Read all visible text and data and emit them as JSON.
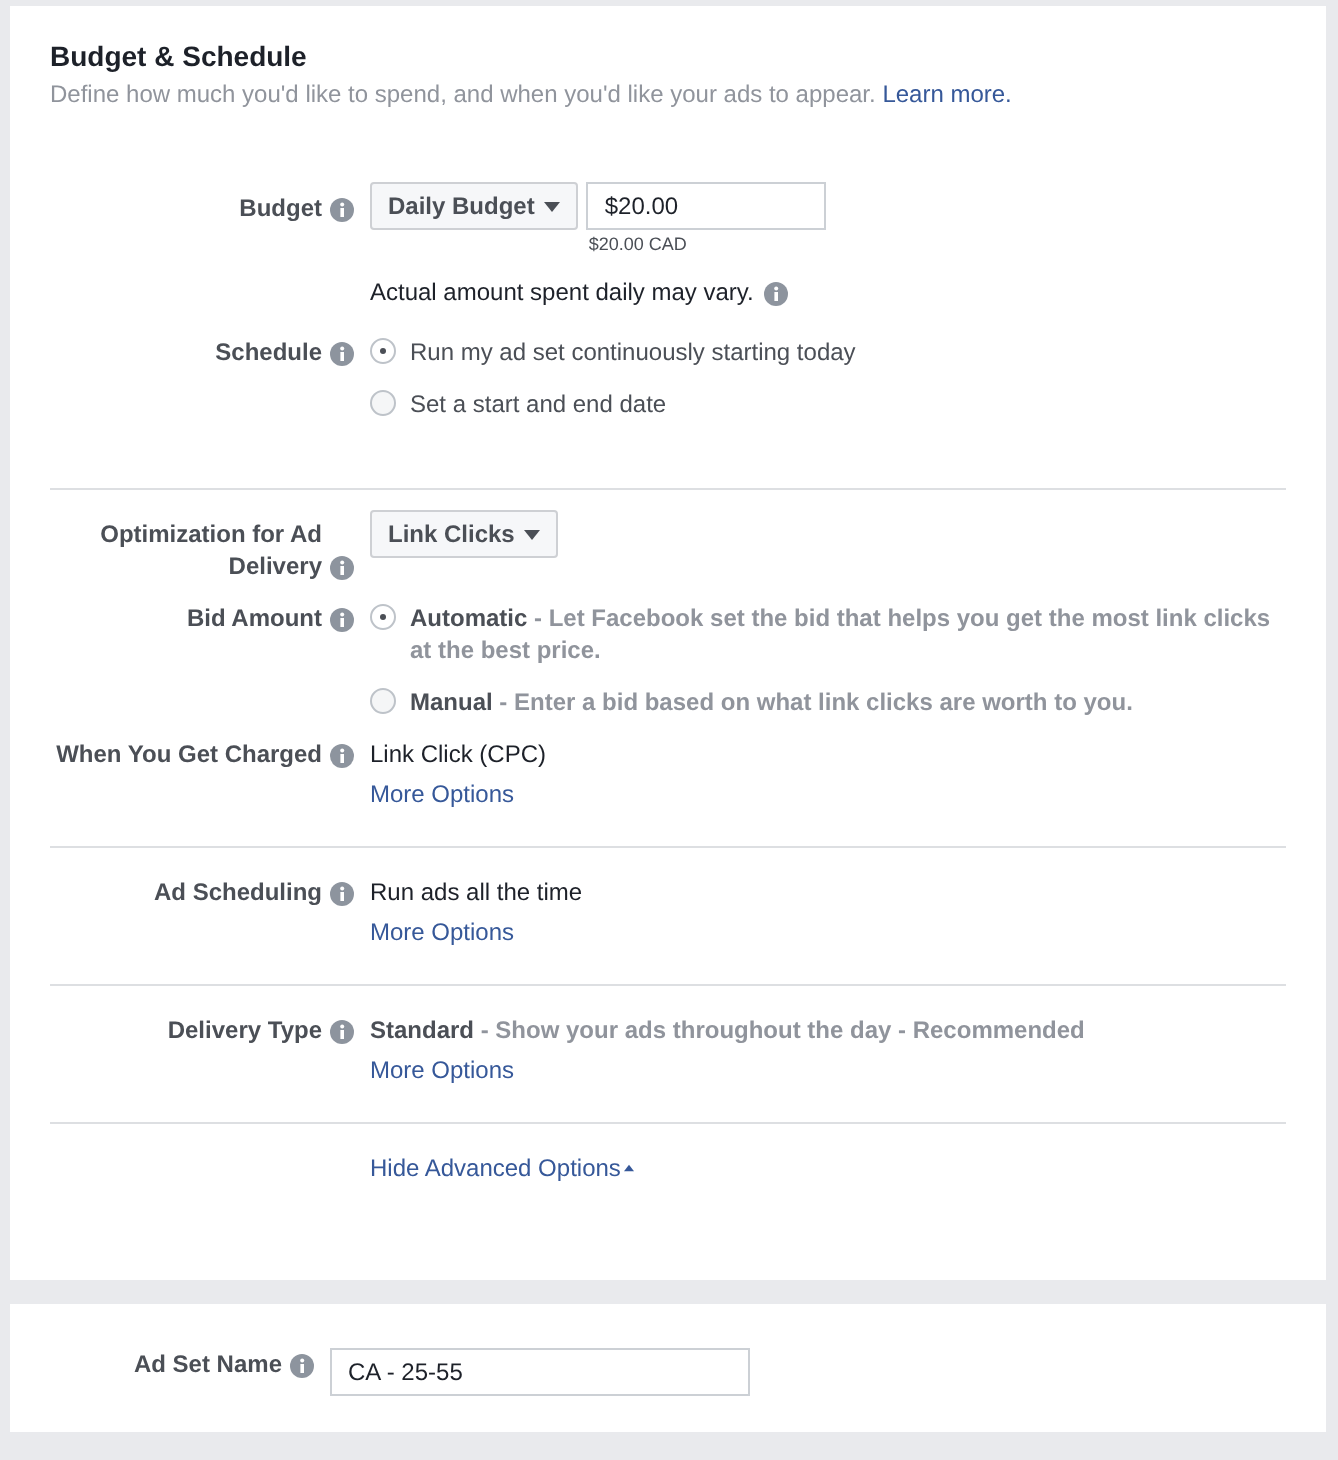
{
  "section": {
    "title": "Budget & Schedule",
    "description": "Define how much you'd like to spend, and when you'd like your ads to appear.",
    "learn_more": "Learn more."
  },
  "groups": [
    {
      "rows": [
        {
          "kind": "budget",
          "label": "Budget",
          "dropdown": "Daily Budget",
          "value": "$20.00",
          "currency_note": "$20.00 CAD"
        },
        {
          "kind": "note",
          "text": "Actual amount spent daily may vary."
        },
        {
          "kind": "radio",
          "label": "Schedule",
          "options": [
            {
              "text": "Run my ad set continuously starting today",
              "selected": true
            },
            {
              "text": "Set a start and end date",
              "selected": false
            }
          ]
        }
      ]
    },
    {
      "rows": [
        {
          "kind": "dropdown",
          "label": "Optimization for Ad Delivery",
          "dropdown": "Link Clicks"
        },
        {
          "kind": "radio",
          "label": "Bid Amount",
          "options": [
            {
              "text": "**Automatic** - Let Facebook set the bid that helps you get the most link clicks at the best price.",
              "selected": true
            },
            {
              "text": "**Manual** - Enter a bid based on what link clicks are worth to you.",
              "selected": false
            }
          ]
        },
        {
          "kind": "value",
          "label": "When You Get Charged",
          "value": "Link Click (CPC)",
          "muted": false,
          "link": "More Options"
        }
      ]
    },
    {
      "rows": [
        {
          "kind": "value",
          "label": "Ad Scheduling",
          "value": "Run ads all the time",
          "muted": false,
          "link": "More Options"
        }
      ]
    },
    {
      "rows": [
        {
          "kind": "value",
          "label": "Delivery Type",
          "value": "**Standard** - Show your ads throughout the day - Recommended",
          "muted": true,
          "link": "More Options"
        }
      ]
    },
    {
      "rows": [
        {
          "kind": "toggle_link",
          "text": "Hide Advanced Options"
        }
      ]
    }
  ],
  "ad_set_name": {
    "label": "Ad Set Name",
    "value": "CA - 25-55"
  }
}
